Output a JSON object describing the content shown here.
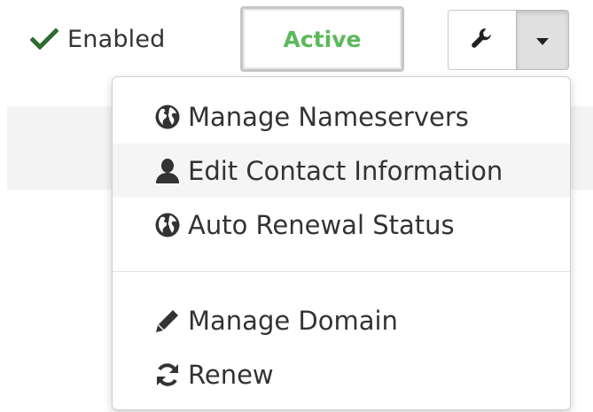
{
  "status": {
    "icon": "check-icon",
    "label": "Enabled",
    "icon_color": "#2e6b2f"
  },
  "badge": {
    "label": "Active",
    "color": "#5cb85c"
  },
  "actions": {
    "tools_icon": "wrench-icon",
    "caret_icon": "caret-down-icon"
  },
  "menu": {
    "groups": [
      [
        {
          "icon": "globe-icon",
          "label": "Manage Nameservers"
        },
        {
          "icon": "user-icon",
          "label": "Edit Contact Information"
        },
        {
          "icon": "globe-icon",
          "label": "Auto Renewal Status"
        }
      ],
      [
        {
          "icon": "pencil-icon",
          "label": "Manage Domain"
        },
        {
          "icon": "refresh-icon",
          "label": "Renew"
        }
      ]
    ]
  }
}
